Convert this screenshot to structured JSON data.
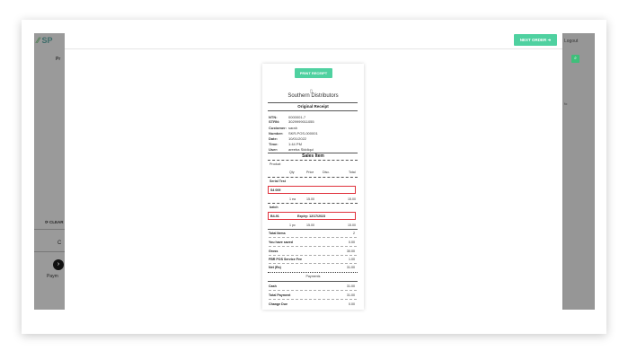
{
  "backdrop": {
    "logo_text": "SP",
    "left_label": "Pr",
    "clear_label": "CLEAR",
    "c_label": "C",
    "payment_label": "Paym",
    "logout_label": "Logout",
    "side_text": "fo"
  },
  "modal": {
    "next_order_label": "NEXT ORDER",
    "next_order_icon": "arrow-right-icon"
  },
  "receipt": {
    "print_label": "PRINT RECEIPT",
    "company": "Southern Distributors",
    "title": "Original Receipt",
    "info": [
      {
        "key": "NTN:",
        "value": "0000001-7"
      },
      {
        "key": "STRN:",
        "value": "3029999011055"
      },
      {
        "key": "Customer:",
        "value": "sarah"
      },
      {
        "key": "Number:",
        "value": "SKR-POS-000001"
      },
      {
        "key": "Date:",
        "value": "10/01/2022"
      },
      {
        "key": "Time:",
        "value": "1:44 PM"
      },
      {
        "key": "User:",
        "value": "areeba Siddiqui"
      }
    ],
    "sales_title": "Sales Item",
    "product_label": "Product",
    "headers": {
      "qty": "Qty",
      "price": "Price",
      "disc": "Disc.",
      "total": "Total"
    },
    "serial": {
      "label": "Serial Test",
      "code": "S4 009",
      "qty": "1 ea",
      "price": "15.00",
      "total": "15.00"
    },
    "batch": {
      "label": "batch",
      "code": "B4-91",
      "expiry": "Expiry: 12/17/2023",
      "qty": "1 pc",
      "price": "15.00",
      "total": "15.00"
    },
    "summary": [
      {
        "label": "Total Items",
        "value": "2"
      },
      {
        "label": "You have saved",
        "value": "0.00"
      },
      {
        "label": "Gross",
        "value": "30.00"
      },
      {
        "label": "FBR POS Service Fee",
        "value": "1.00"
      },
      {
        "label": "Net (Rs)",
        "value": "31.00"
      }
    ],
    "payments_title": "Payments",
    "payments": [
      {
        "label": "Cash",
        "value": "31.00"
      },
      {
        "label": "Total Payment",
        "value": "31.00"
      },
      {
        "label": "Change Due",
        "value": "0.00"
      }
    ]
  },
  "colors": {
    "accent": "#4fd1a0",
    "highlight": "#e0313c"
  }
}
